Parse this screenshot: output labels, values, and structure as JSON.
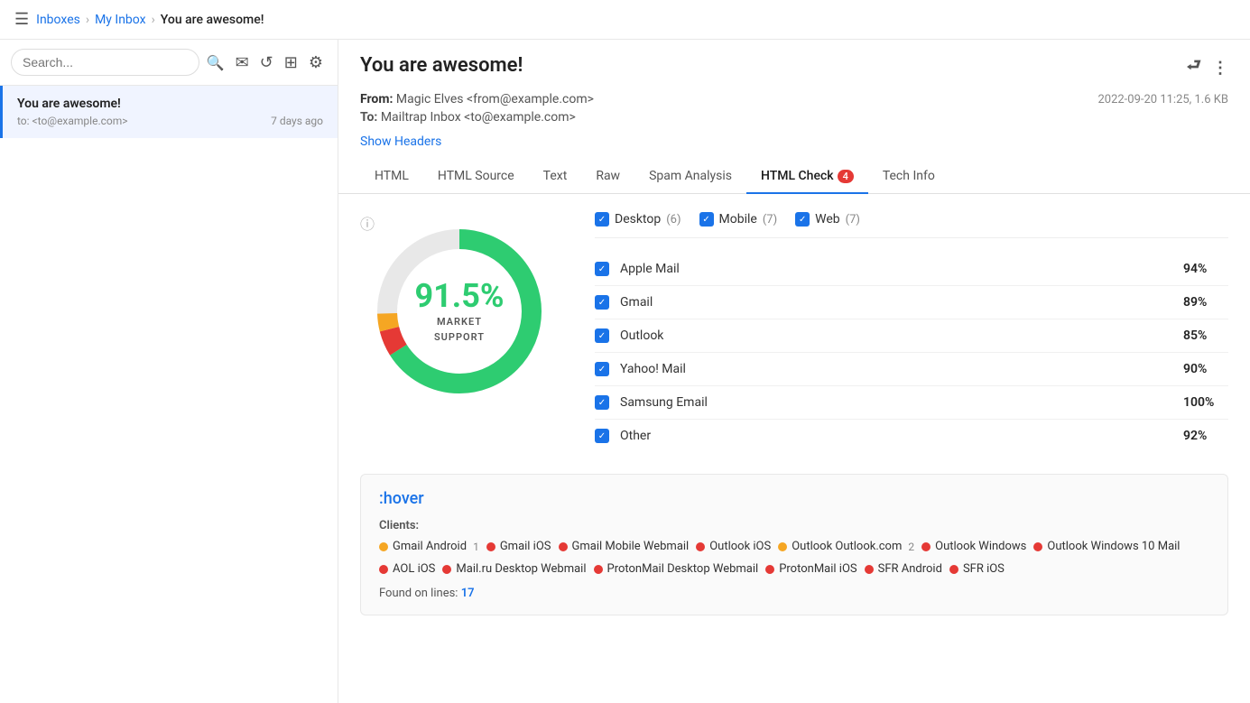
{
  "nav": {
    "hamburger": "☰",
    "breadcrumbs": [
      "Inboxes",
      "My Inbox",
      "You are awesome!"
    ]
  },
  "sidebar": {
    "search_placeholder": "Search...",
    "mail_items": [
      {
        "title": "You are awesome!",
        "to": "to: <to@example.com>",
        "date": "7 days ago",
        "active": true
      }
    ]
  },
  "email": {
    "subject": "You are awesome!",
    "from_label": "From:",
    "from_name": "Magic Elves",
    "from_email": "<from@example.com>",
    "to_label": "To:",
    "to_name": "Mailtrap Inbox",
    "to_email": "<to@example.com>",
    "date": "2022-09-20 11:25, 1.6 KB",
    "show_headers": "Show Headers"
  },
  "tabs": [
    {
      "label": "HTML",
      "active": false,
      "badge": null
    },
    {
      "label": "HTML Source",
      "active": false,
      "badge": null
    },
    {
      "label": "Text",
      "active": false,
      "badge": null
    },
    {
      "label": "Raw",
      "active": false,
      "badge": null
    },
    {
      "label": "Spam Analysis",
      "active": false,
      "badge": null
    },
    {
      "label": "HTML Check",
      "active": true,
      "badge": "4"
    },
    {
      "label": "Tech Info",
      "active": false,
      "badge": null
    }
  ],
  "html_check": {
    "donut": {
      "percent": "91.5%",
      "label_line1": "MARKET",
      "label_line2": "SUPPORT",
      "segments": [
        {
          "label": "green",
          "value": 91.5,
          "color": "#2ecc71"
        },
        {
          "label": "red",
          "value": 5,
          "color": "#e53935"
        },
        {
          "label": "orange",
          "value": 3.5,
          "color": "#f5a623"
        }
      ]
    },
    "filters": [
      {
        "label": "Desktop",
        "count": "(6)"
      },
      {
        "label": "Mobile",
        "count": "(7)"
      },
      {
        "label": "Web",
        "count": "(7)"
      }
    ],
    "clients": [
      {
        "name": "Apple Mail",
        "percent": "94%"
      },
      {
        "name": "Gmail",
        "percent": "89%"
      },
      {
        "name": "Outlook",
        "percent": "85%"
      },
      {
        "name": "Yahoo! Mail",
        "percent": "90%"
      },
      {
        "name": "Samsung Email",
        "percent": "100%"
      },
      {
        "name": "Other",
        "percent": "92%"
      }
    ],
    "hover_section": {
      "title": ":hover",
      "clients_label": "Clients:",
      "client_tags": [
        {
          "name": "Gmail Android",
          "count": "1",
          "dot": "orange"
        },
        {
          "name": "Gmail iOS",
          "count": null,
          "dot": "red"
        },
        {
          "name": "Gmail Mobile Webmail",
          "count": null,
          "dot": "red"
        },
        {
          "name": "Outlook iOS",
          "count": null,
          "dot": "red"
        },
        {
          "name": "Outlook Outlook.com",
          "count": "2",
          "dot": "orange"
        },
        {
          "name": "Outlook Windows",
          "count": null,
          "dot": "red"
        },
        {
          "name": "Outlook Windows 10 Mail",
          "count": null,
          "dot": "red"
        },
        {
          "name": "AOL iOS",
          "count": null,
          "dot": "red"
        },
        {
          "name": "Mail.ru Desktop Webmail",
          "count": null,
          "dot": "red"
        },
        {
          "name": "ProtonMail Desktop Webmail",
          "count": null,
          "dot": "red"
        },
        {
          "name": "ProtonMail iOS",
          "count": null,
          "dot": "red"
        },
        {
          "name": "SFR Android",
          "count": null,
          "dot": "red"
        },
        {
          "name": "SFR iOS",
          "count": null,
          "dot": "red"
        }
      ],
      "found_label": "Found on lines:",
      "found_count": "17"
    }
  }
}
